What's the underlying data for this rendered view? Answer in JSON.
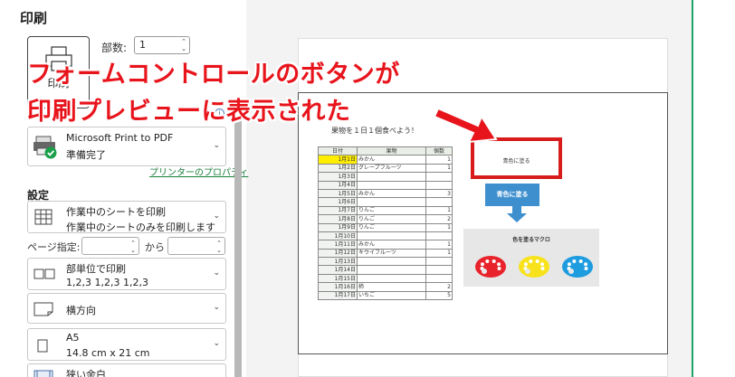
{
  "print": {
    "title": "印刷",
    "button_label": "印刷",
    "copies_label": "部数:",
    "copies_value": "1"
  },
  "printer": {
    "name": "Microsoft Print to PDF",
    "status": "準備完了",
    "properties_link": "プリンターのプロパティ"
  },
  "settings": {
    "label": "設定",
    "scope_title": "作業中のシートを印刷",
    "scope_desc": "作業中のシートのみを印刷します",
    "pages_label": "ページ指定:",
    "to_label": "から",
    "collate_title": "部単位で印刷",
    "collate_desc": "1,2,3    1,2,3    1,2,3",
    "orientation": "横方向",
    "paper_name": "A5",
    "paper_size": "14.8 cm x 21 cm",
    "margins": "狭い余白"
  },
  "overlay": {
    "line1": "フォームコントロールのボタンが",
    "line2": "印刷プレビューに表示された"
  },
  "preview": {
    "sheet_title": "果物を１日１個食べよう！",
    "headers": [
      "日付",
      "果物",
      "個数"
    ],
    "rows": [
      {
        "date": "1月1日",
        "fruit": "みかん",
        "count": "1"
      },
      {
        "date": "1月2日",
        "fruit": "グレープフルーツ",
        "count": "1"
      },
      {
        "date": "1月3日",
        "fruit": "",
        "count": ""
      },
      {
        "date": "1月4日",
        "fruit": "",
        "count": ""
      },
      {
        "date": "1月5日",
        "fruit": "みかん",
        "count": "3"
      },
      {
        "date": "1月6日",
        "fruit": "",
        "count": ""
      },
      {
        "date": "1月7日",
        "fruit": "りんご",
        "count": "1"
      },
      {
        "date": "1月8日",
        "fruit": "りんご",
        "count": "2"
      },
      {
        "date": "1月9日",
        "fruit": "りんご",
        "count": "1"
      },
      {
        "date": "1月10日",
        "fruit": "",
        "count": ""
      },
      {
        "date": "1月11日",
        "fruit": "みかん",
        "count": "1"
      },
      {
        "date": "1月12日",
        "fruit": "キウイフルーツ",
        "count": "1"
      },
      {
        "date": "1月13日",
        "fruit": "",
        "count": ""
      },
      {
        "date": "1月14日",
        "fruit": "",
        "count": ""
      },
      {
        "date": "1月15日",
        "fruit": "",
        "count": ""
      },
      {
        "date": "1月16日",
        "fruit": "柿",
        "count": "2"
      },
      {
        "date": "1月17日",
        "fruit": "いちご",
        "count": "5"
      }
    ],
    "highlight_color": "#ffee00",
    "red_button_label": "青色に塗る",
    "blue_button_label": "青色に塗る",
    "macro_title": "色を塗るマクロ",
    "palette_colors": [
      "#e8232b",
      "#f7e21b",
      "#1e9ce0"
    ]
  },
  "colors": {
    "accent_red": "#e8141c",
    "link_green": "#1a7f3c",
    "excel_green": "#21a366"
  }
}
